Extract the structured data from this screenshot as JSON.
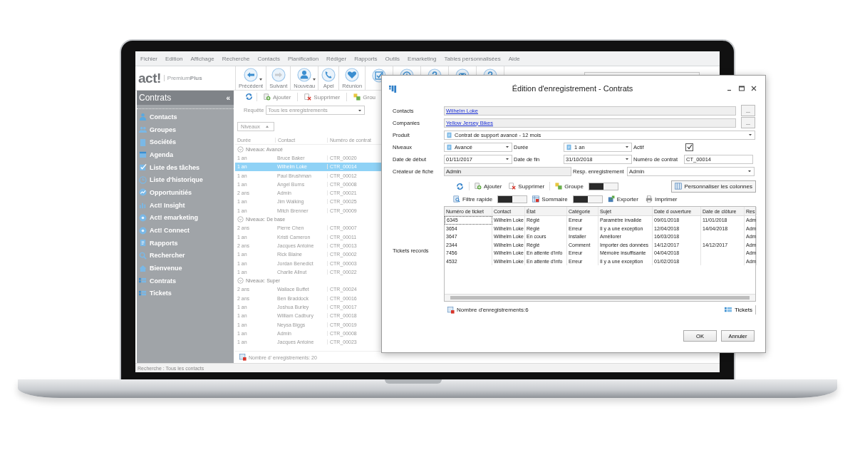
{
  "menu": [
    {
      "label": "Fichier"
    },
    {
      "label": "Edition"
    },
    {
      "label": "Affichage"
    },
    {
      "label": "Recherche"
    },
    {
      "label": "Contacts"
    },
    {
      "label": "Planification"
    },
    {
      "label": "Rédiger"
    },
    {
      "label": "Rapports"
    },
    {
      "label": "Outils"
    },
    {
      "label": "Emarketing"
    },
    {
      "label": "Tables personnalisées"
    },
    {
      "label": "Aide"
    }
  ],
  "logo": {
    "brand": "act!",
    "edition": "Premium",
    "edition_bold": "Plus"
  },
  "toolbar": [
    {
      "label": "Précédent",
      "dropdown": true
    },
    {
      "label": "Suivant",
      "dropdown": false
    },
    {
      "label": "Nouveau",
      "dropdown": true
    },
    {
      "label": "Apel",
      "dropdown": false
    },
    {
      "label": "Réunion",
      "dropdown": false
    }
  ],
  "sidebar": {
    "title": "Contrats",
    "collapse": "«",
    "items": [
      {
        "label": "Contacts"
      },
      {
        "label": "Groupes"
      },
      {
        "label": "Sociétés"
      },
      {
        "label": "Agenda"
      },
      {
        "label": "Liste des tâches"
      },
      {
        "label": "Liste d'historique"
      },
      {
        "label": "Opportunitiés"
      },
      {
        "label": "Act! Insight"
      },
      {
        "label": "Act! emarketing"
      },
      {
        "label": "Act! Connect"
      },
      {
        "label": "Rapports"
      },
      {
        "label": "Rechercher"
      },
      {
        "label": "Bienvenue"
      },
      {
        "label": "Contrats"
      },
      {
        "label": "Tickets"
      }
    ]
  },
  "list": {
    "toolbar": [
      "Ajouter",
      "Supprimer",
      "Grou"
    ],
    "query_label": "Requête",
    "query": "Tous les enregistrements",
    "group_chip": "Niveaux",
    "columns": [
      "Durée",
      "Contact",
      "Numéro de contrat"
    ],
    "groups": [
      {
        "label": "Niveaux: Avancé",
        "rows": [
          {
            "duration": "1 an",
            "contact": "Bruce Baker",
            "number": "CTR_00020",
            "selected": false
          },
          {
            "duration": "1 an",
            "contact": "Wilhelm Loke",
            "number": "CTR_00014",
            "selected": true
          },
          {
            "duration": "1 an",
            "contact": "Paul Brushman",
            "number": "CTR_00012",
            "selected": false
          },
          {
            "duration": "1 an",
            "contact": "Angel Burns",
            "number": "CTR_00008",
            "selected": false
          },
          {
            "duration": "2 ans",
            "contact": "Admin",
            "number": "CTR_00021",
            "selected": false
          },
          {
            "duration": "1 an",
            "contact": "Jim Walking",
            "number": "CTR_00025",
            "selected": false
          },
          {
            "duration": "1 an",
            "contact": "Mitch Brenner",
            "number": "CTR_00009",
            "selected": false
          }
        ]
      },
      {
        "label": "Niveaux: De base",
        "rows": [
          {
            "duration": "2 ans",
            "contact": "Pierre Chen",
            "number": "CTR_00007",
            "selected": false
          },
          {
            "duration": "1 an",
            "contact": "Kristi Cameron",
            "number": "CTR_00011",
            "selected": false
          },
          {
            "duration": "2 ans",
            "contact": "Jacques Antoine",
            "number": "CTR_00013",
            "selected": false
          },
          {
            "duration": "1 an",
            "contact": "Rick Blaine",
            "number": "CTR_00002",
            "selected": false
          },
          {
            "duration": "1 an",
            "contact": "Jordan Benedict",
            "number": "CTR_00003",
            "selected": false
          },
          {
            "duration": "1 an",
            "contact": "Charlie Allnut",
            "number": "CTR_00022",
            "selected": false
          }
        ]
      },
      {
        "label": "Niveaux: Super",
        "rows": [
          {
            "duration": "2 ans",
            "contact": "Wallace Buffet",
            "number": "CTR_00024",
            "selected": false
          },
          {
            "duration": "2 ans",
            "contact": "Ben Braddock",
            "number": "CTR_00016",
            "selected": false
          },
          {
            "duration": "1 an",
            "contact": "Joshua Burley",
            "number": "CTR_00017",
            "selected": false
          },
          {
            "duration": "1 an",
            "contact": "William Cadbury",
            "number": "CTR_00018",
            "selected": false
          },
          {
            "duration": "1 an",
            "contact": "Neysa Biggs",
            "number": "CTR_00019",
            "selected": false
          },
          {
            "duration": "1 an",
            "contact": "Admin",
            "number": "CTR_00008",
            "selected": false
          },
          {
            "duration": "1 an",
            "contact": "Jacques Antoine",
            "number": "CTR_00023",
            "selected": false
          }
        ]
      }
    ],
    "footer": "Nombre d' enregistrements: 20"
  },
  "status_bar": "Recherche : Tous les contacts",
  "dialog": {
    "title": "Édition d'enregistrement - Contrats",
    "contacts": {
      "label": "Contacts",
      "value": "Wilhelm Loke",
      "browse": "..."
    },
    "companies": {
      "label": "Companies",
      "value": "Yellow Jersey Bikes",
      "browse": "..."
    },
    "product": {
      "label": "Produit",
      "value": "Contrat de support avancé - 12 mois"
    },
    "levels": {
      "label": "Niveaux",
      "value": "Avancé"
    },
    "duration": {
      "label": "Durée",
      "value": "1 an"
    },
    "active": {
      "label": "Actif",
      "checked": true
    },
    "start_date": {
      "label": "Date de début",
      "value": "01/11/2017"
    },
    "end_date": {
      "label": "Date de fin",
      "value": "31/10/2018"
    },
    "contract_number": {
      "label": "Numéro de contrat",
      "value": "CT_00014"
    },
    "creator": {
      "label": "Créateur de fiche",
      "value": "Admin"
    },
    "owner": {
      "label": "Resp. enregistrement",
      "value": "Admin"
    },
    "tickets_label": "Tickets records",
    "toolbar": [
      {
        "kind": "refresh"
      },
      {
        "kind": "button",
        "label": "Ajouter"
      },
      {
        "kind": "button",
        "label": "Supprimer"
      },
      {
        "kind": "toggle",
        "label": "Groupe",
        "on": false
      }
    ],
    "customize": "Personnaliser les colonnes",
    "toolbar2": [
      {
        "kind": "toggle",
        "label": "Filtre rapide",
        "on": false
      },
      {
        "kind": "toggle",
        "label": "Sommaire",
        "on": false
      },
      {
        "kind": "button",
        "label": "Exporter"
      },
      {
        "kind": "button",
        "label": "Imprimer"
      }
    ],
    "columns": [
      "Numéro de ticket",
      "Contact",
      "État",
      "Catégorie",
      "Sujet",
      "Date d ouverture",
      "Date de clôture",
      "Res"
    ],
    "rows": [
      {
        "focused": true,
        "cells": [
          "6345",
          "Wilhelm Loke",
          "Réglé",
          "Erreur",
          "Paramètre invalide",
          "09/01/2018",
          "11/01/2018",
          "Adm"
        ]
      },
      {
        "focused": false,
        "cells": [
          "3654",
          "Wilhelm Loke",
          "Réglé",
          "Erreur",
          "Il y a une exception",
          "12/04/2018",
          "14/04/2018",
          "Adm"
        ]
      },
      {
        "focused": false,
        "cells": [
          "3647",
          "Wilhelm Loke",
          "En cours",
          "Installer",
          "Améliorer",
          "16/03/2018",
          "",
          "Adm"
        ]
      },
      {
        "focused": false,
        "cells": [
          "2344",
          "Wilhelm Loke",
          "Réglé",
          "Comment",
          "Importer des données",
          "14/12/2017",
          "14/12/2017",
          "Adm"
        ]
      },
      {
        "focused": false,
        "cells": [
          "7456",
          "Wilhelm Loke",
          "En attente d'info",
          "Erreur",
          "Mémoire insuffisante",
          "04/04/2018",
          "",
          "Adm"
        ]
      },
      {
        "focused": false,
        "cells": [
          "4532",
          "Wilhelm Loke",
          "En attente d'info",
          "Erreur",
          "Il y a une exception",
          "01/02/2018",
          "",
          "Adm"
        ]
      }
    ],
    "count": "Nombre d'enregistrements:6",
    "tickets_button": "Tickets",
    "buttons": [
      "OK",
      "Annuler"
    ]
  }
}
